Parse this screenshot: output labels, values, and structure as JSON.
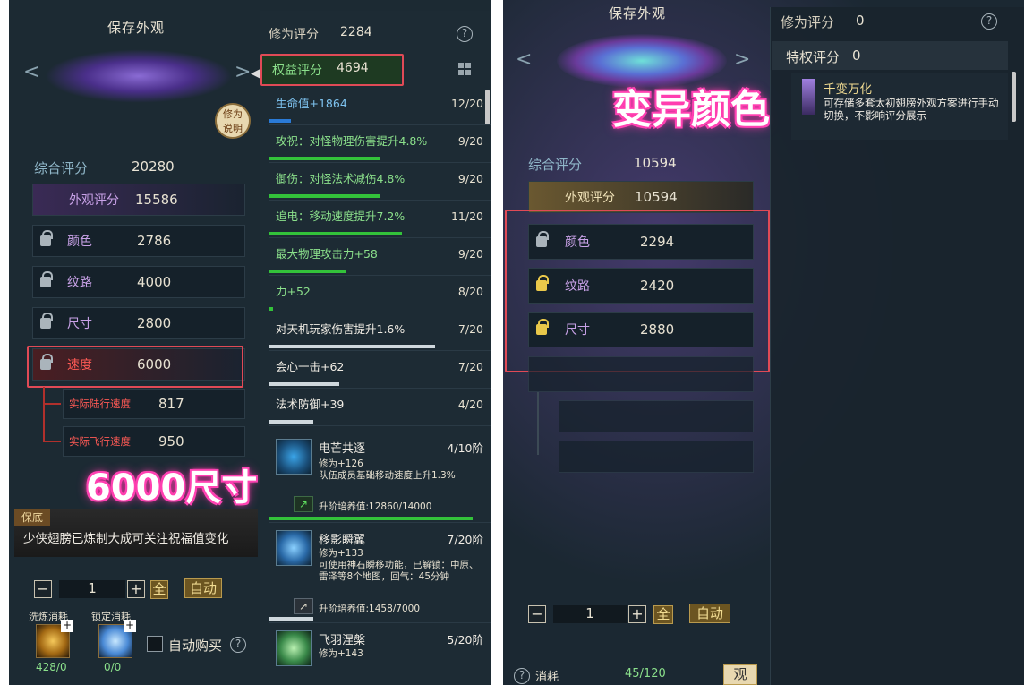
{
  "left": {
    "save_title": "保存外观",
    "help_badge": "修为\n说明",
    "score_label": "综合评分",
    "score_value": "20280",
    "appearance_label": "外观评分",
    "appearance_value": "15586",
    "attrs": [
      {
        "label": "颜色",
        "value": "2786"
      },
      {
        "label": "纹路",
        "value": "4000"
      },
      {
        "label": "尺寸",
        "value": "2800"
      },
      {
        "label": "速度",
        "value": "6000"
      }
    ],
    "speed_children": [
      {
        "label": "实际陆行速度",
        "value": "817"
      },
      {
        "label": "实际飞行速度",
        "value": "950"
      }
    ],
    "overlay": "6000尺寸",
    "notice_tag": "保底",
    "notice_text": "少侠翅膀已炼制大成可关注祝福值变化",
    "qty": "1",
    "all_label": "全",
    "auto_label": "自动",
    "cost1_label": "洗炼消耗",
    "cost1_count": "428/0",
    "cost2_label": "锁定消耗",
    "cost2_count": "0/0",
    "auto_buy": "自动购买",
    "cultivation_label": "修为评分",
    "cultivation_value": "2284",
    "rights_label": "权益评分",
    "rights_value": "4694",
    "stats": [
      {
        "text": "生命值+1864",
        "count": "12/20",
        "fill": 0.1,
        "style": "blue"
      },
      {
        "text": "攻祝：对怪物理伤害提升4.8%",
        "count": "9/20",
        "fill": 0.5,
        "style": "green"
      },
      {
        "text": "御伤：对怪法术减伤4.8%",
        "count": "9/20",
        "fill": 0.5,
        "style": "green"
      },
      {
        "text": "追电：移动速度提升7.2%",
        "count": "11/20",
        "fill": 0.6,
        "style": "green"
      },
      {
        "text": "最大物理攻击力+58",
        "count": "9/20",
        "fill": 0.35,
        "style": "green"
      },
      {
        "text": "力+52",
        "count": "8/20",
        "fill": 0.02,
        "style": "green"
      },
      {
        "text": "对天机玩家伤害提升1.6%",
        "count": "7/20",
        "fill": 0.75,
        "style": "white"
      },
      {
        "text": "会心一击+62",
        "count": "7/20",
        "fill": 0.32,
        "style": "white"
      },
      {
        "text": "法术防御+39",
        "count": "4/20",
        "fill": 0.2,
        "style": "white"
      }
    ],
    "skills": [
      {
        "name": "电芒共逐",
        "level": "4/10阶",
        "desc": "修为+126\n队伍成员基础移动速度上升1.3%",
        "cult": "升阶培养值:12860/14000",
        "fill": 0.92
      },
      {
        "name": "移影瞬翼",
        "level": "7/20阶",
        "desc": "修为+133\n可使用神石瞬移功能，已解锁：中原、雷泽等8个地图，回气：45分钟",
        "cult": "升阶培养值:1458/7000",
        "fill": 0.2
      },
      {
        "name": "飞羽涅槃",
        "level": "5/20阶",
        "desc": "修为+143",
        "cult": "",
        "fill": 0
      }
    ]
  },
  "right": {
    "save_title": "保存外观",
    "score_label": "综合评分",
    "score_value": "10594",
    "appearance_label": "外观评分",
    "appearance_value": "10594",
    "attrs": [
      {
        "label": "颜色",
        "value": "2294",
        "lock": "grey"
      },
      {
        "label": "纹路",
        "value": "2420",
        "lock": "gold"
      },
      {
        "label": "尺寸",
        "value": "2880",
        "lock": "gold"
      }
    ],
    "overlay": "变异颜色",
    "cultivation_label": "修为评分",
    "cultivation_value": "0",
    "privilege_label": "特权评分",
    "privilege_value": "0",
    "tooltip_title": "千变万化",
    "tooltip_text": "可存储多套太初翅膀外观方案进行手动切换，不影响评分展示",
    "qty": "1",
    "all_label": "全",
    "auto_label": "自动",
    "cost_label": "消耗",
    "cost_value": "45/120",
    "view_label": "观"
  },
  "colors": {
    "accent": "#e04a56",
    "overlay": "#ff3cae"
  }
}
